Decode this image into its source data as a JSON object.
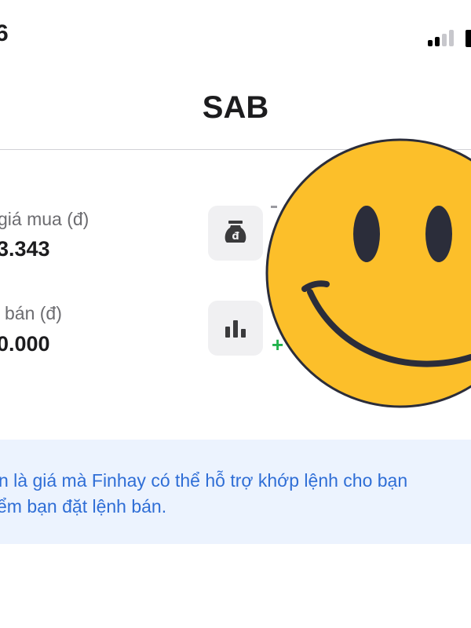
{
  "status_bar": {
    "time": "6"
  },
  "header": {
    "title": "SAB"
  },
  "rows": [
    {
      "label": "giá mua (đ)",
      "value": "3.343"
    },
    {
      "label": "bán (đ)",
      "value": "0.000"
    }
  ],
  "partial_glyphs": {
    "plus": "+"
  },
  "info": {
    "line1": "n là giá mà Finhay có thể hỗ trợ khớp lệnh cho bạn",
    "line2": "ểm bạn đặt lệnh bán."
  },
  "colors": {
    "accent_blue": "#2f6ed6",
    "info_bg": "#ecf3fe",
    "positive": "#22b24c",
    "smiley_fill": "#fcbf2a",
    "smiley_stroke": "#2b2d3a"
  },
  "icons": [
    "money-bag-dong-icon",
    "bar-chart-icon",
    "smiley-face-sticker"
  ]
}
